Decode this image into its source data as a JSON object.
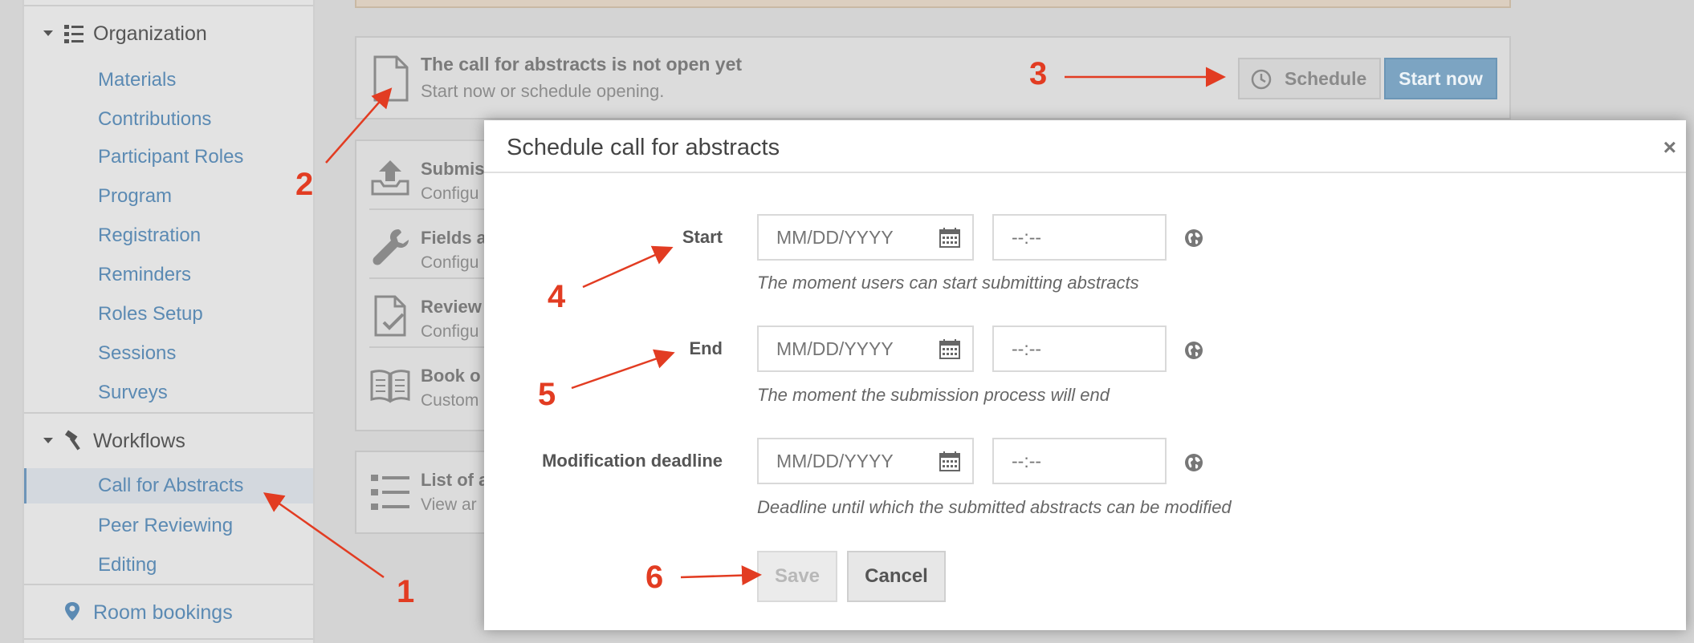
{
  "sidebar": {
    "organization": {
      "label": "Organization",
      "items": [
        "Materials",
        "Contributions",
        "Participant Roles",
        "Program",
        "Registration",
        "Reminders",
        "Roles Setup",
        "Sessions",
        "Surveys"
      ]
    },
    "workflows": {
      "label": "Workflows",
      "items": [
        "Call for Abstracts",
        "Peer Reviewing",
        "Editing"
      ],
      "active": "Call for Abstracts"
    },
    "room_bookings": "Room bookings"
  },
  "cfa_status": {
    "title": "The call for abstracts is not open yet",
    "subtitle": "Start now or schedule opening.",
    "schedule_label": "Schedule",
    "start_now_label": "Start now"
  },
  "settings_rows": [
    {
      "title": "Submis",
      "subtitle": "Configu"
    },
    {
      "title": "Fields a",
      "subtitle": "Configu"
    },
    {
      "title": "Review",
      "subtitle": "Configu"
    },
    {
      "title": "Book o",
      "subtitle": "Custom"
    }
  ],
  "list_row": {
    "title": "List of a",
    "subtitle": "View ar"
  },
  "modal": {
    "title": "Schedule call for abstracts",
    "close": "×",
    "fields": [
      {
        "label": "Start",
        "date_placeholder": "MM/DD/YYYY",
        "time_placeholder": "--:--",
        "help": "The moment users can start submitting abstracts"
      },
      {
        "label": "End",
        "date_placeholder": "MM/DD/YYYY",
        "time_placeholder": "--:--",
        "help": "The moment the submission process will end"
      },
      {
        "label": "Modification deadline",
        "date_placeholder": "MM/DD/YYYY",
        "time_placeholder": "--:--",
        "help": "Deadline until which the submitted abstracts can be modified"
      }
    ],
    "save_label": "Save",
    "cancel_label": "Cancel"
  },
  "annotations": [
    "1",
    "2",
    "3",
    "4",
    "5",
    "6"
  ],
  "colors": {
    "annotation": "#e23c22",
    "link": "#5b8ab3",
    "primary_button": "#7ca4c2"
  }
}
